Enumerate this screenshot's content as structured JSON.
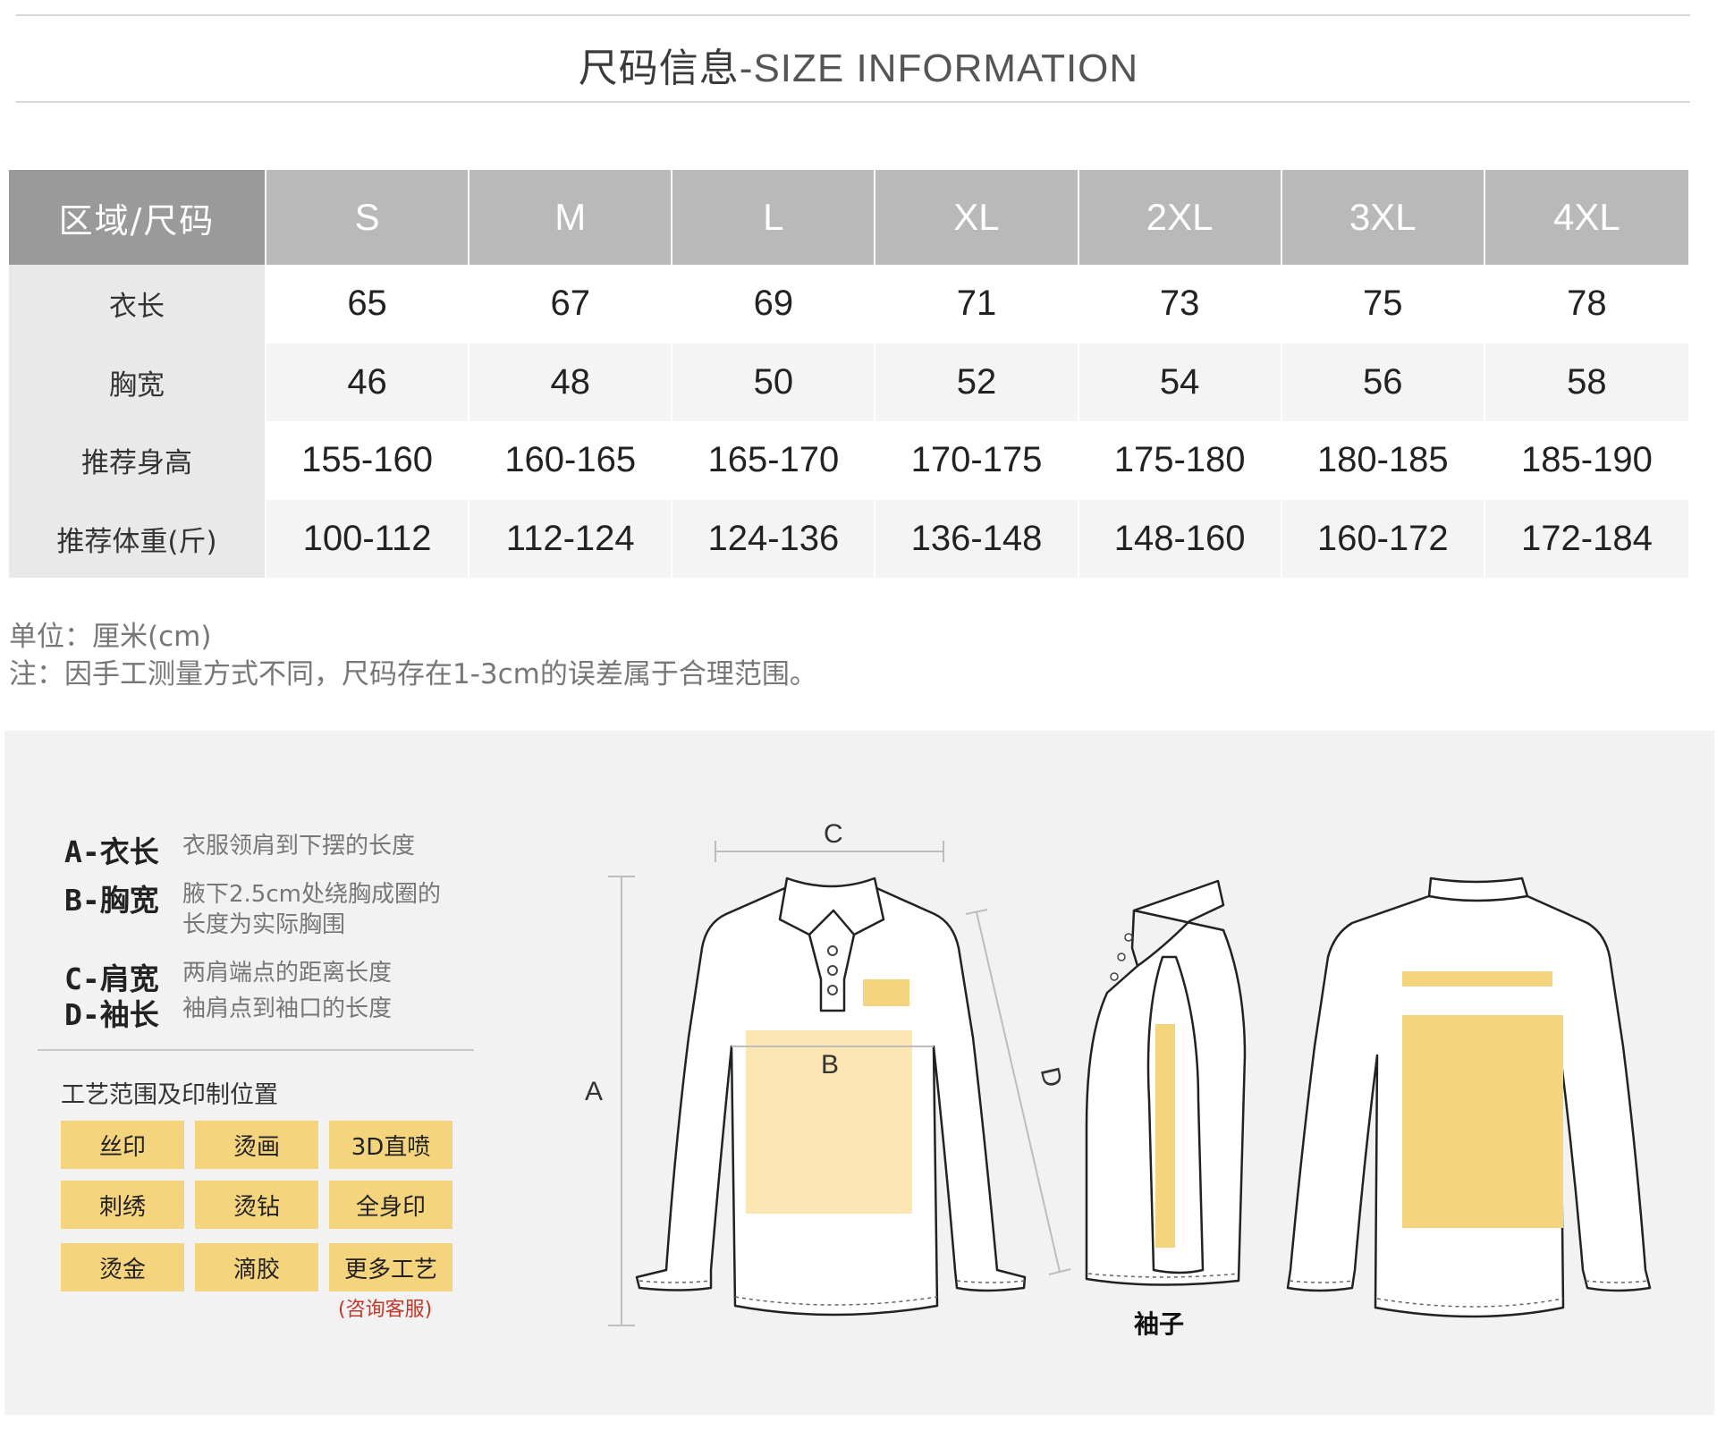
{
  "header": {
    "title_cn": "尺码信息",
    "title_en": "-SIZE INFORMATION"
  },
  "size_table": {
    "corner": "区域/尺码",
    "sizes": [
      "S",
      "M",
      "L",
      "XL",
      "2XL",
      "3XL",
      "4XL"
    ],
    "rows": [
      {
        "label": "衣长",
        "values": [
          "65",
          "67",
          "69",
          "71",
          "73",
          "75",
          "78"
        ]
      },
      {
        "label": "胸宽",
        "values": [
          "46",
          "48",
          "50",
          "52",
          "54",
          "56",
          "58"
        ]
      },
      {
        "label": "推荐身高",
        "values": [
          "155-160",
          "160-165",
          "165-170",
          "170-175",
          "175-180",
          "180-185",
          "185-190"
        ]
      },
      {
        "label": "推荐体重(斤)",
        "values": [
          "100-112",
          "112-124",
          "124-136",
          "136-148",
          "148-160",
          "160-172",
          "172-184"
        ]
      }
    ]
  },
  "notes": {
    "unit": "单位：厘米(cm)",
    "remark": "注：因手工测量方式不同，尺码存在1-3cm的误差属于合理范围。"
  },
  "definitions": [
    {
      "key": "A-衣长",
      "desc": "衣服领肩到下摆的长度"
    },
    {
      "key": "B-胸宽",
      "desc": "腋下2.5cm处绕胸成圈的长度为实际胸围"
    },
    {
      "key": "C-肩宽",
      "desc": "两肩端点的距离长度"
    },
    {
      "key": "D-袖长",
      "desc": "袖肩点到袖口的长度"
    }
  ],
  "craft": {
    "title": "工艺范围及印制位置",
    "items": [
      "丝印",
      "烫画",
      "3D直喷",
      "刺绣",
      "烫钻",
      "全身印",
      "烫金",
      "滴胶",
      "更多工艺"
    ],
    "consult": "(咨询客服)"
  },
  "diagram": {
    "label_a": "A",
    "label_b": "B",
    "label_c": "C",
    "label_d": "D",
    "sleeve_label": "袖子",
    "print_color": "#f5d47e",
    "print_color_light": "#fbe6b4"
  }
}
